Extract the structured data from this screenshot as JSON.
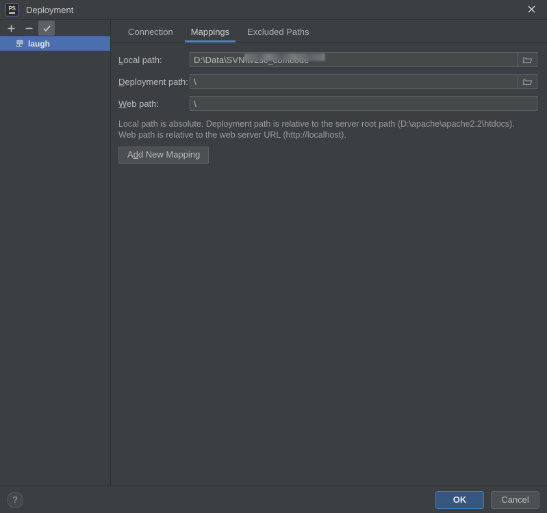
{
  "window": {
    "title": "Deployment",
    "app_icon": "phpstorm-icon",
    "app_icon_text": "PS",
    "close_icon": "close-icon"
  },
  "sidebar": {
    "toolbar": [
      {
        "name": "add-server-button",
        "icon": "plus-icon",
        "label": "+",
        "pressed": false
      },
      {
        "name": "remove-server-button",
        "icon": "minus-icon",
        "label": "−",
        "pressed": false
      },
      {
        "name": "set-default-server-button",
        "icon": "check-icon",
        "label": "✓",
        "pressed": true
      }
    ],
    "servers": [
      {
        "name": "laugh",
        "icon": "remote-server-icon",
        "selected": true
      }
    ]
  },
  "tabs": [
    {
      "label": "Connection",
      "active": false
    },
    {
      "label": "Mappings",
      "active": true
    },
    {
      "label": "Excluded Paths",
      "active": false
    }
  ],
  "form": {
    "local_path": {
      "label_pre": "",
      "label_mn": "L",
      "label_post": "ocal path:",
      "value": "D:\\Data\\SVN\\tv2sc_comcode",
      "placeholder": "",
      "browse_icon": "folder-open-icon",
      "redacted": true
    },
    "deployment_path": {
      "label_pre": "",
      "label_mn": "D",
      "label_post": "eployment path:",
      "value": "\\",
      "placeholder": "",
      "browse_icon": "folder-open-icon",
      "redacted": false
    },
    "web_path": {
      "label_pre": "",
      "label_mn": "W",
      "label_post": "eb path:",
      "value": "\\",
      "placeholder": "",
      "browse_icon": null,
      "redacted": false
    },
    "hint_line1": "Local path is absolute. Deployment path is relative to the server root path (D:\\apache\\apache2.2\\htdocs).",
    "hint_line2": "Web path is relative to the web server URL (http://localhost).",
    "add_mapping": {
      "pre": "A",
      "mn": "d",
      "post": "d New Mapping"
    }
  },
  "footer": {
    "help_label": "?",
    "ok_label": "OK",
    "cancel_label": "Cancel"
  },
  "colors": {
    "background": "#3c3f41",
    "selection": "#4b6eaf",
    "tab_underline": "#4a88c7",
    "primary_button": "#365880",
    "field_background": "#45494a",
    "text": "#bbbbbb"
  }
}
